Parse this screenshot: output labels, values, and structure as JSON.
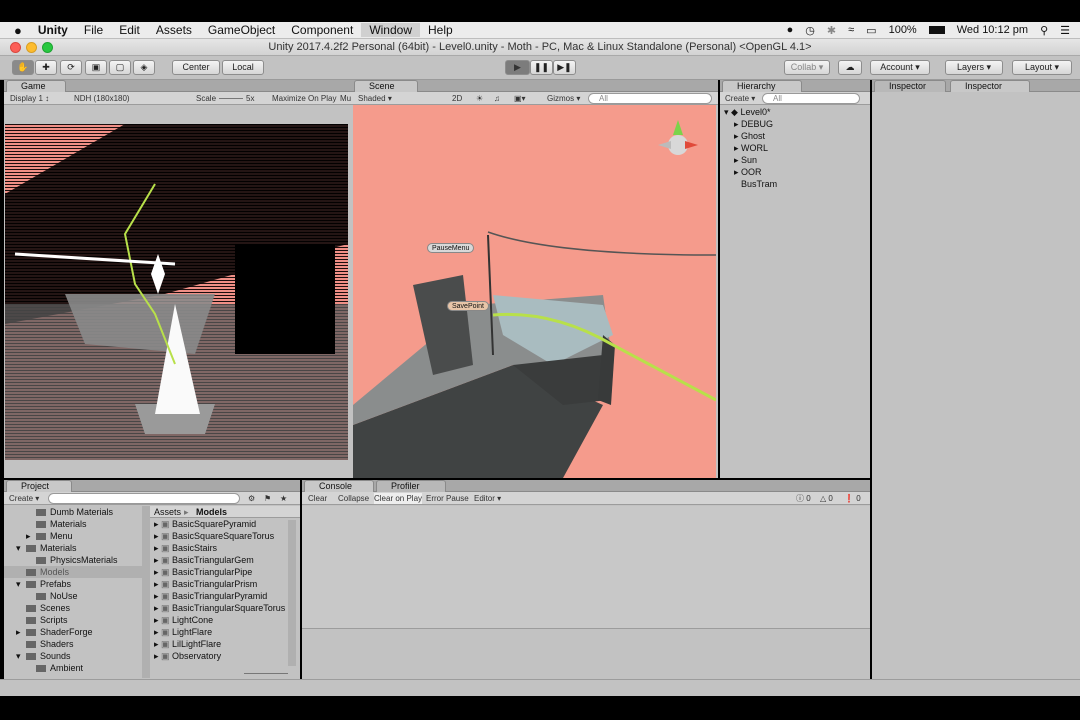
{
  "menubar": {
    "app": "Unity",
    "items": [
      "File",
      "Edit",
      "Assets",
      "GameObject",
      "Component",
      "Window",
      "Help"
    ],
    "battery": "100%",
    "clock": "Wed 10:12 pm"
  },
  "window": {
    "title": "Unity 2017.4.2f2 Personal (64bit) - Level0.unity - Moth - PC, Mac & Linux Standalone (Personal) <OpenGL 4.1>"
  },
  "toolbar": {
    "center": "Center",
    "local": "Local",
    "collab": "Collab",
    "account": "Account",
    "layers": "Layers",
    "layout": "Layout"
  },
  "game": {
    "tab": "Game",
    "display": "Display 1",
    "resolution": "NDH (180x180)",
    "scale_label": "Scale",
    "scale_value": "5x",
    "maximize": "Maximize On Play",
    "mute": "Mu"
  },
  "scene": {
    "tab": "Scene",
    "shading": "Shaded",
    "mode": "2D",
    "gizmos": "Gizmos",
    "search": "All",
    "labels": {
      "pause": "PauseMenu",
      "save": "SavePoint"
    }
  },
  "hierarchy": {
    "tab": "Hierarchy",
    "create": "Create",
    "search": "All",
    "root": "Level0*",
    "items": [
      "DEBUG",
      "Ghost",
      "WORL",
      "Sun",
      "OOR",
      "BusTram"
    ]
  },
  "inspector": {
    "tabs": [
      "Inspector",
      "Inspector"
    ]
  },
  "project": {
    "tab": "Project",
    "create": "Create",
    "tree": [
      {
        "label": "Dumb Materials",
        "level": 2,
        "arrow": false
      },
      {
        "label": "Materials",
        "level": 2,
        "arrow": false
      },
      {
        "label": "Menu",
        "level": 2,
        "arrow": true
      },
      {
        "label": "Materials",
        "level": 1,
        "arrow": true,
        "open": true
      },
      {
        "label": "PhysicsMaterials",
        "level": 2,
        "arrow": false
      },
      {
        "label": "Models",
        "level": 1,
        "arrow": false,
        "selected": true
      },
      {
        "label": "Prefabs",
        "level": 1,
        "arrow": true,
        "open": true
      },
      {
        "label": "NoUse",
        "level": 2,
        "arrow": false
      },
      {
        "label": "Scenes",
        "level": 1,
        "arrow": false
      },
      {
        "label": "Scripts",
        "level": 1,
        "arrow": false
      },
      {
        "label": "ShaderForge",
        "level": 1,
        "arrow": true
      },
      {
        "label": "Shaders",
        "level": 1,
        "arrow": false
      },
      {
        "label": "Sounds",
        "level": 1,
        "arrow": true,
        "open": true
      },
      {
        "label": "Ambient",
        "level": 2,
        "arrow": false
      }
    ],
    "crumb_root": "Assets",
    "crumb_current": "Models",
    "files": [
      "BasicSquarePyramid",
      "BasicSquareSquareTorus",
      "BasicStairs",
      "BasicTriangularGem",
      "BasicTriangularPipe",
      "BasicTriangularPrism",
      "BasicTriangularPyramid",
      "BasicTriangularSquareTorus",
      "LightCone",
      "LightFlare",
      "LilLightFlare",
      "Observatory"
    ]
  },
  "console": {
    "tab": "Console",
    "profiler": "Profiler",
    "clear": "Clear",
    "collapse": "Collapse",
    "clear_on_play": "Clear on Play",
    "error_pause": "Error Pause",
    "editor": "Editor",
    "counts": [
      "0",
      "0",
      "0"
    ]
  },
  "colors": {
    "scene_bg": "#f59b8c",
    "panel": "#c2c2c2",
    "line": "#b8e04a"
  }
}
